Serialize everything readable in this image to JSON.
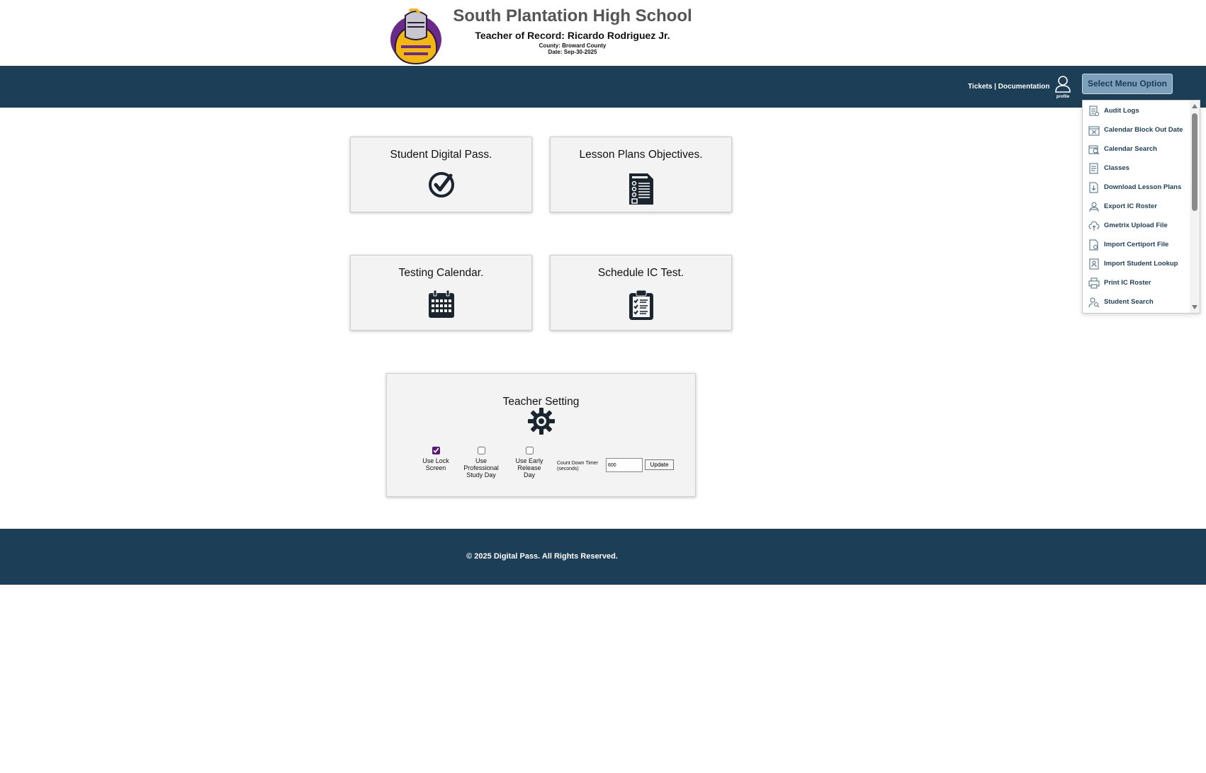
{
  "header": {
    "school_name": "South Plantation High School",
    "teacher_line": "Teacher of Record: Ricardo Rodriguez Jr.",
    "county_line": "County: Broward County",
    "date_line": "Date: Sep-30-2025"
  },
  "navbar": {
    "tickets_label": "Tickets",
    "separator": " | ",
    "documentation_label": "Documentation",
    "profile_label": "profile",
    "menu_button_label": "Select Menu Option",
    "accent_color": "#1c3e57"
  },
  "dropdown": {
    "items": [
      {
        "label": "Audit Logs",
        "icon": "audit-log-icon"
      },
      {
        "label": "Calendar Block Out Date",
        "icon": "calendar-block-icon"
      },
      {
        "label": "Calendar Search",
        "icon": "calendar-search-icon"
      },
      {
        "label": "Classes",
        "icon": "classes-icon"
      },
      {
        "label": "Download Lesson Plans",
        "icon": "download-file-icon"
      },
      {
        "label": "Export IC Roster",
        "icon": "export-roster-icon"
      },
      {
        "label": "Gmetrix Upload File",
        "icon": "cloud-upload-icon"
      },
      {
        "label": "Import Certiport File",
        "icon": "import-file-icon"
      },
      {
        "label": "Import Student Lookup",
        "icon": "import-student-icon"
      },
      {
        "label": "Print IC Roster",
        "icon": "printer-icon"
      },
      {
        "label": "Student Search",
        "icon": "student-search-icon"
      }
    ]
  },
  "cards": {
    "digital_pass": {
      "title": "Student Digital Pass.",
      "icon": "check-circle-icon"
    },
    "lesson_plans": {
      "title": "Lesson Plans Objectives.",
      "icon": "lesson-plan-icon"
    },
    "testing_calendar": {
      "title": "Testing Calendar.",
      "icon": "calendar-icon"
    },
    "schedule_test": {
      "title": "Schedule IC Test.",
      "icon": "clipboard-checklist-icon"
    }
  },
  "settings": {
    "title": "Teacher Setting",
    "lock_screen": {
      "label": "Use Lock Screen",
      "checked": true
    },
    "professional_study": {
      "label": "Use Professional Study Day",
      "checked": false
    },
    "early_release": {
      "label": "Use Early Release Day",
      "checked": false
    },
    "timer_label": "Count Down Timer (seconds)",
    "timer_value": "600",
    "update_label": "Update"
  },
  "footer": {
    "copyright": "© 2025 Digital Pass. All Rights Reserved."
  }
}
